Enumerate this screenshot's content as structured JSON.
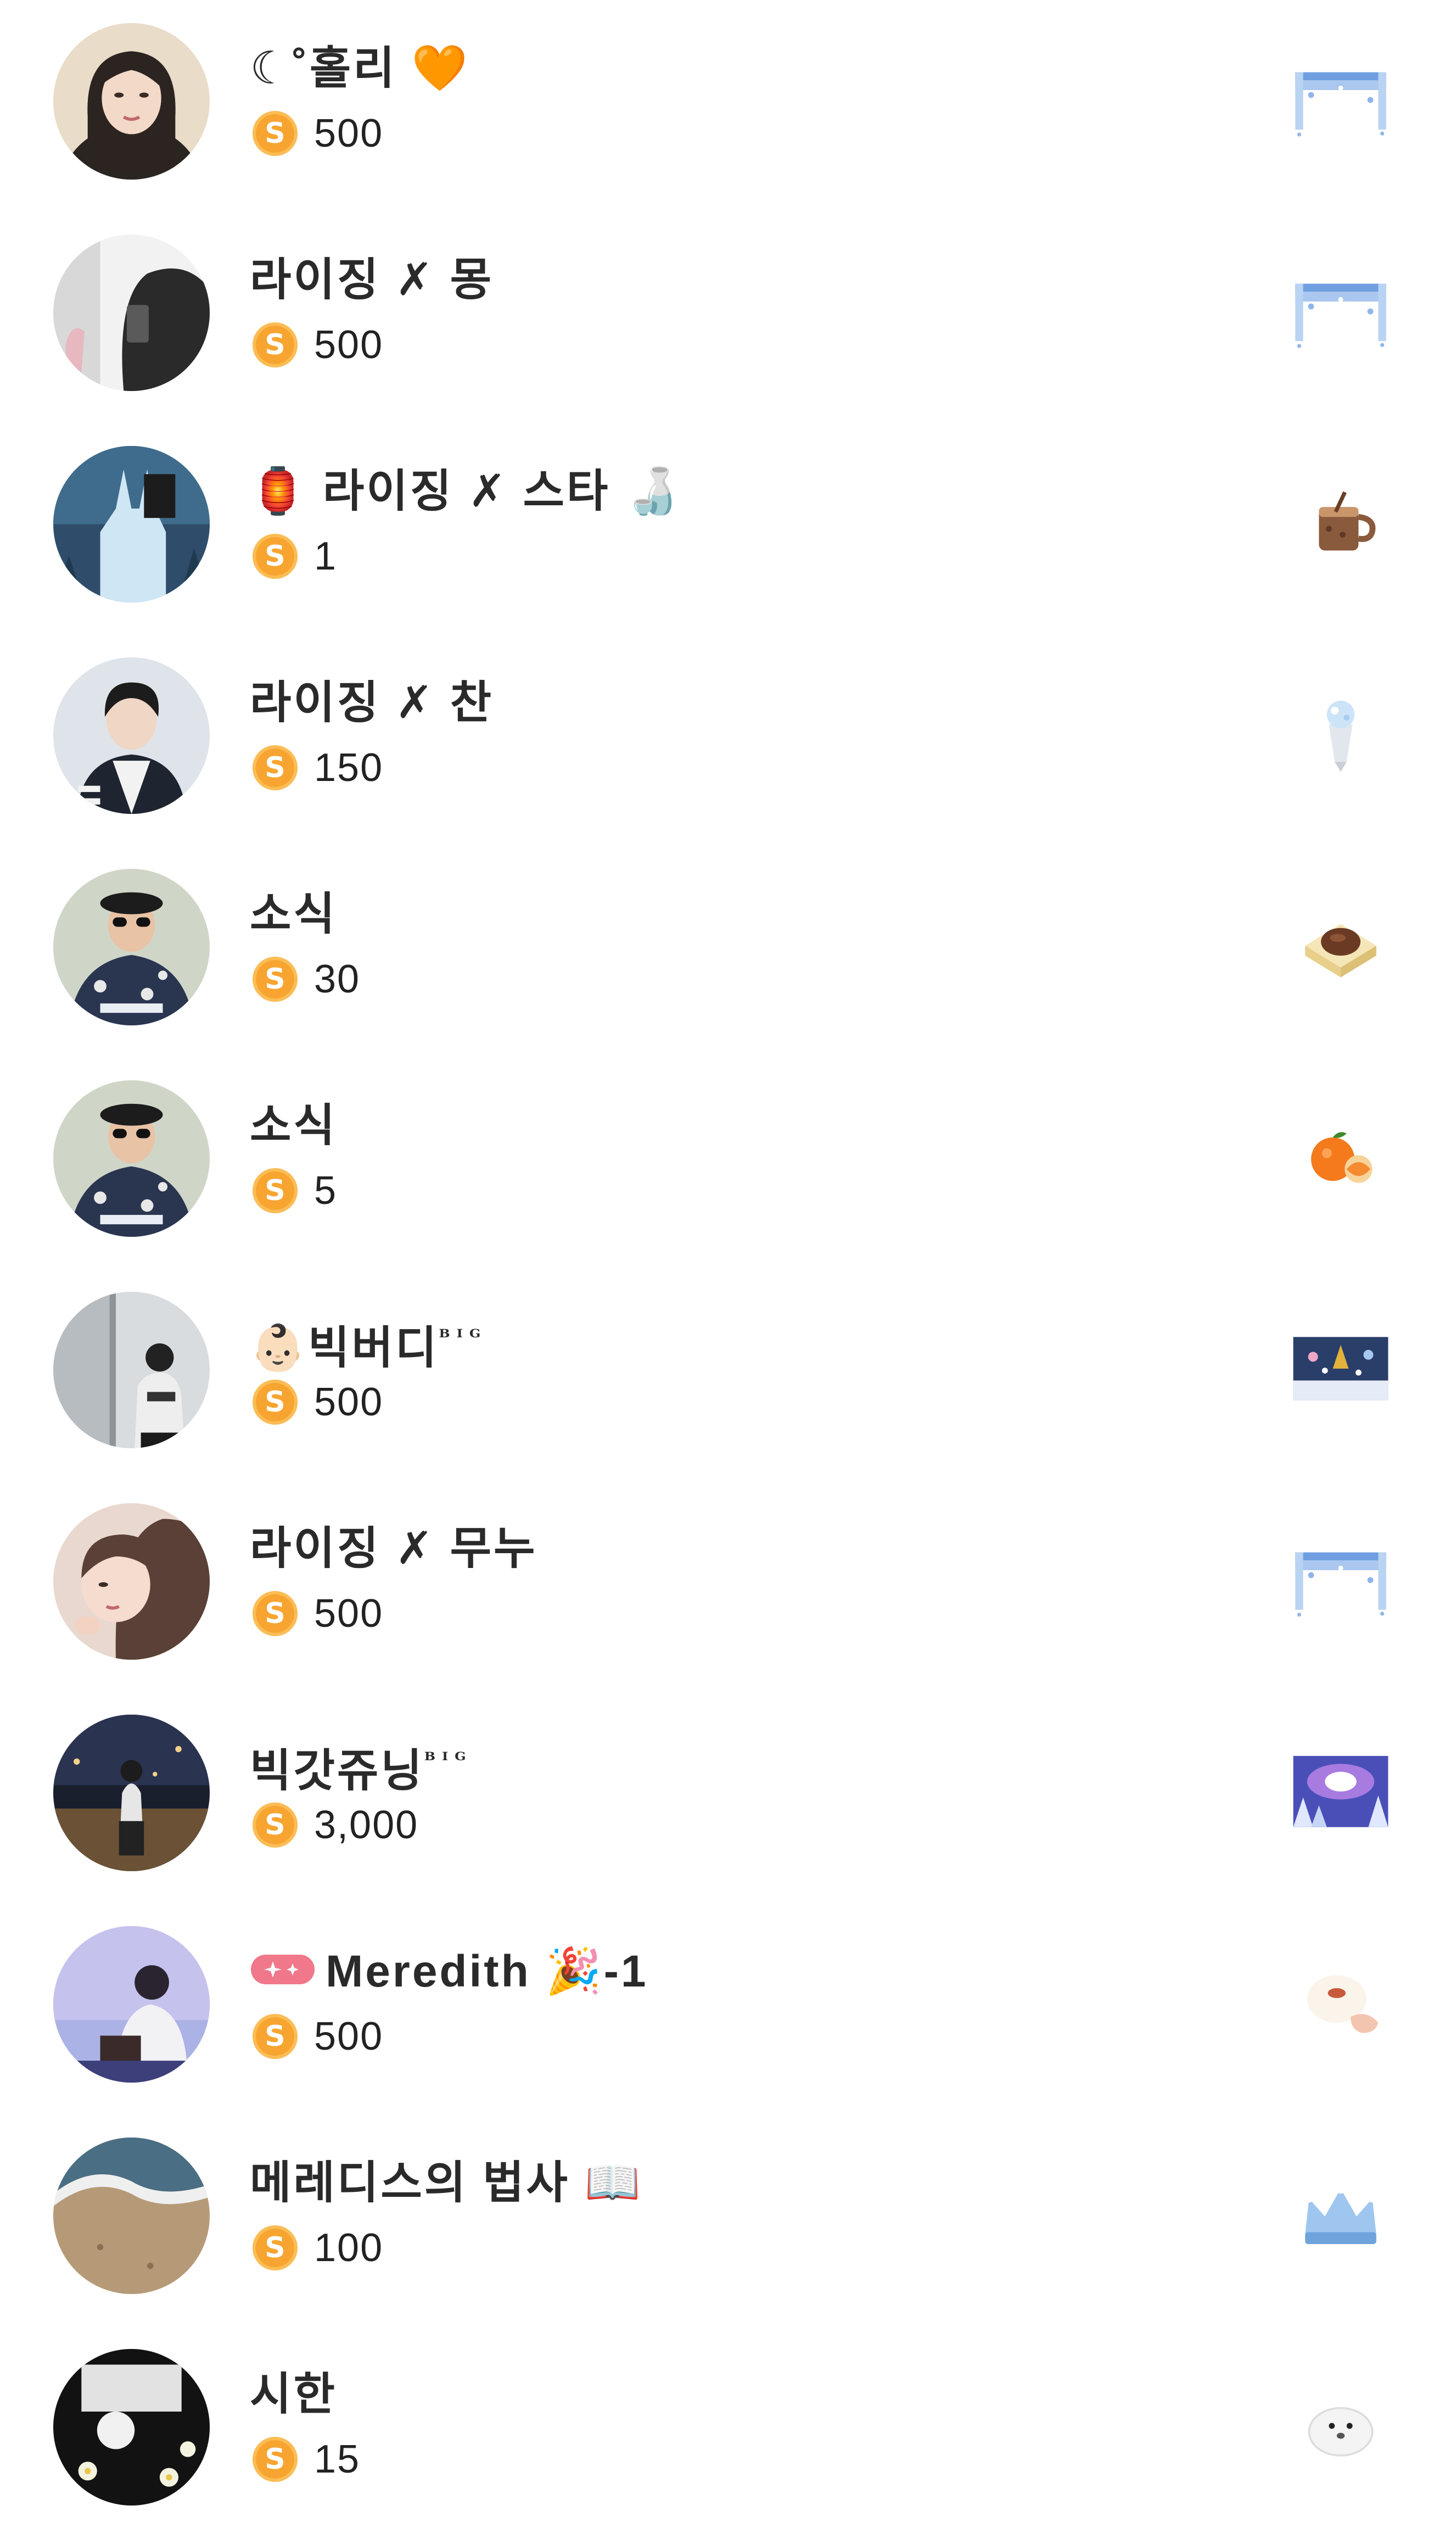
{
  "rows": [
    {
      "name": "☾˚홀리 🧡",
      "amount": "500",
      "gift": "icy-frame-gift"
    },
    {
      "name": "라이징 ✗ 몽",
      "amount": "500",
      "gift": "icy-frame-gift"
    },
    {
      "name": "🏮 라이징 ✗ 스타 🍶",
      "amount": "1",
      "gift": "coffee-mug-gift"
    },
    {
      "name": "라이징 ✗ 찬",
      "amount": "150",
      "gift": "diamond-bouquet-gift"
    },
    {
      "name": "소식",
      "amount": "30",
      "gift": "chocolate-cake-gift"
    },
    {
      "name": "소식",
      "amount": "5",
      "gift": "tangerine-gift"
    },
    {
      "name": "👶🏻빅버디",
      "sup": "ᴮᴵᴳ",
      "amount": "500",
      "gift": "ornament-stage-gift"
    },
    {
      "name": "라이징 ✗ 무누",
      "amount": "500",
      "gift": "icy-frame-gift"
    },
    {
      "name": "빅갓쥬닝",
      "sup": "ᴮᴵᴳ",
      "amount": "3,000",
      "gift": "aurora-forest-gift"
    },
    {
      "name": "Meredith 🎉-1",
      "amount": "500",
      "gift": "bun-in-hand-gift",
      "badge": "sparkle-badge"
    },
    {
      "name": "메레디스의 법사 📖",
      "amount": "100",
      "gift": "crystal-crown-gift"
    },
    {
      "name": "시한",
      "amount": "15",
      "gift": "white-seal-gift"
    }
  ],
  "coin_symbol": "S",
  "colors": {
    "coin": "#f7a530",
    "name_text": "#2a2a2a",
    "badge": "#f0788a"
  }
}
